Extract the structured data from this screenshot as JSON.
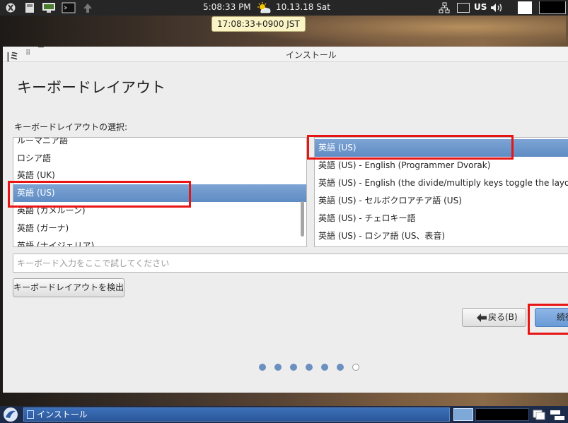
{
  "top_panel": {
    "time": "5:08:33 PM",
    "date": "10.13.18 Sat",
    "keyboard_indicator": "US",
    "tooltip": "17:08:33+0900 JST"
  },
  "window": {
    "title": "インストール",
    "logo": "|ミ",
    "page_title": "キーボードレイアウト",
    "section_label": "キーボードレイアウトの選択:",
    "left_list": [
      "ルーマニア語",
      "ロシア語",
      "英語 (UK)",
      "英語 (US)",
      "英語 (カメルーン)",
      "英語 (ガーナ)",
      "英語 (ナイジェリア)"
    ],
    "right_list": [
      "英語 (US)",
      "英語 (US) - English (Programmer Dvorak)",
      "英語 (US) - English (the divide/multiply keys toggle the layout)",
      "英語 (US) - セルボクロアチア語 (US)",
      "英語 (US) - チェロキー語",
      "英語 (US) - ロシア語 (US、表音)"
    ],
    "test_placeholder": "キーボード入力をここで試してください",
    "detect_button": "キーボードレイアウトを検出",
    "back_button": "戻る(B)",
    "continue_button": "続行"
  },
  "taskbar": {
    "task_label": "インストール"
  },
  "colors": {
    "selection": "#6f98cc",
    "annotation": "#e81515",
    "panel": "#262626",
    "taskbar": "#1d2b4a"
  }
}
